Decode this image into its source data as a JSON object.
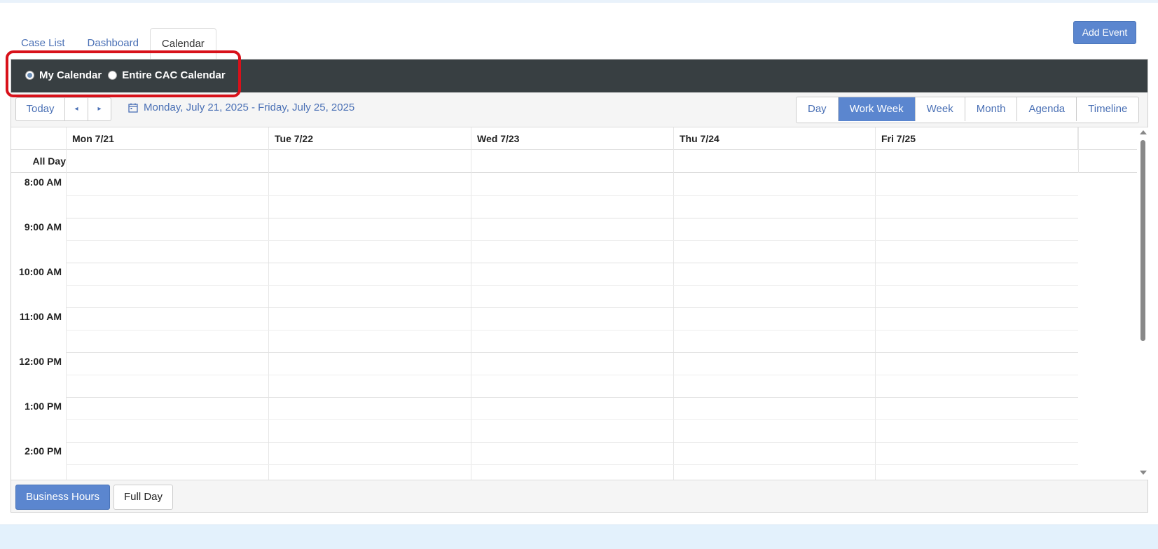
{
  "tabs": [
    {
      "label": "Case List",
      "active": false
    },
    {
      "label": "Dashboard",
      "active": false
    },
    {
      "label": "Calendar",
      "active": true
    }
  ],
  "add_event_label": "Add Event",
  "calendar_filter": {
    "options": [
      {
        "label": "My Calendar",
        "checked": true
      },
      {
        "label": "Entire CAC Calendar",
        "checked": false
      }
    ]
  },
  "toolbar": {
    "today_label": "Today",
    "prev_label": "◂",
    "next_label": "▸",
    "date_range": "Monday, July 21, 2025 - Friday, July 25, 2025",
    "calendar_icon": "calendar-icon",
    "views": [
      {
        "label": "Day",
        "active": false
      },
      {
        "label": "Work Week",
        "active": true
      },
      {
        "label": "Week",
        "active": false
      },
      {
        "label": "Month",
        "active": false
      },
      {
        "label": "Agenda",
        "active": false
      },
      {
        "label": "Timeline",
        "active": false
      }
    ]
  },
  "grid": {
    "days": [
      "Mon 7/21",
      "Tue 7/22",
      "Wed 7/23",
      "Thu 7/24",
      "Fri 7/25"
    ],
    "all_day_label": "All Day",
    "times": [
      "8:00 AM",
      "9:00 AM",
      "10:00 AM",
      "11:00 AM",
      "12:00 PM",
      "1:00 PM",
      "2:00 PM"
    ]
  },
  "footer": {
    "business_hours_label": "Business Hours",
    "full_day_label": "Full Day"
  },
  "colors": {
    "accent": "#5b86cf",
    "dark_bar": "#383f42",
    "highlight": "#d8111a",
    "link": "#4a70b5"
  }
}
